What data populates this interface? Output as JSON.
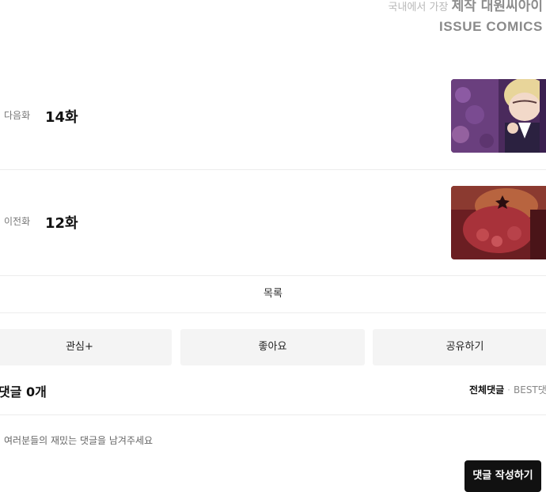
{
  "header": {
    "credit_text": "국내에서 가장",
    "credit_strong": "제작 대원씨아이",
    "brand": "ISSUE COMICS"
  },
  "episodes": {
    "next": {
      "kind": "다음화",
      "title": "14화"
    },
    "prev": {
      "kind": "이전화",
      "title": "12화"
    }
  },
  "list_label": "목록",
  "actions": {
    "subscribe": "관심+",
    "like": "좋아요",
    "share": "공유하기"
  },
  "comments": {
    "count_label": "댓글 0개",
    "tab_all": "전체댓글",
    "separator": "·",
    "tab_best": "BEST댓",
    "placeholder": "여러분들의 재밌는 댓글을 남겨주세요",
    "write_button": "댓글 작성하기"
  }
}
